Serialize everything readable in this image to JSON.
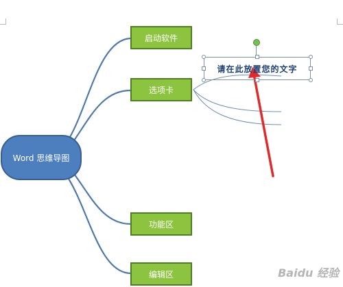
{
  "diagram": {
    "root_label": "Word 思维导图",
    "nodes": [
      {
        "label": "启动软件"
      },
      {
        "label": "选项卡"
      },
      {
        "label": "功能区"
      },
      {
        "label": "编辑区"
      }
    ],
    "textbox_text": "请在此放置您的文字",
    "watermark_text": "Baidu 经验"
  },
  "colors": {
    "root_fill": "#4d7ebd",
    "root_border": "#355f94",
    "node_fill": "#8cc43f",
    "node_border": "#4f7d24",
    "connector": "#4f79a8",
    "arrow": "#e12b2b",
    "handle_green": "#74c150"
  }
}
